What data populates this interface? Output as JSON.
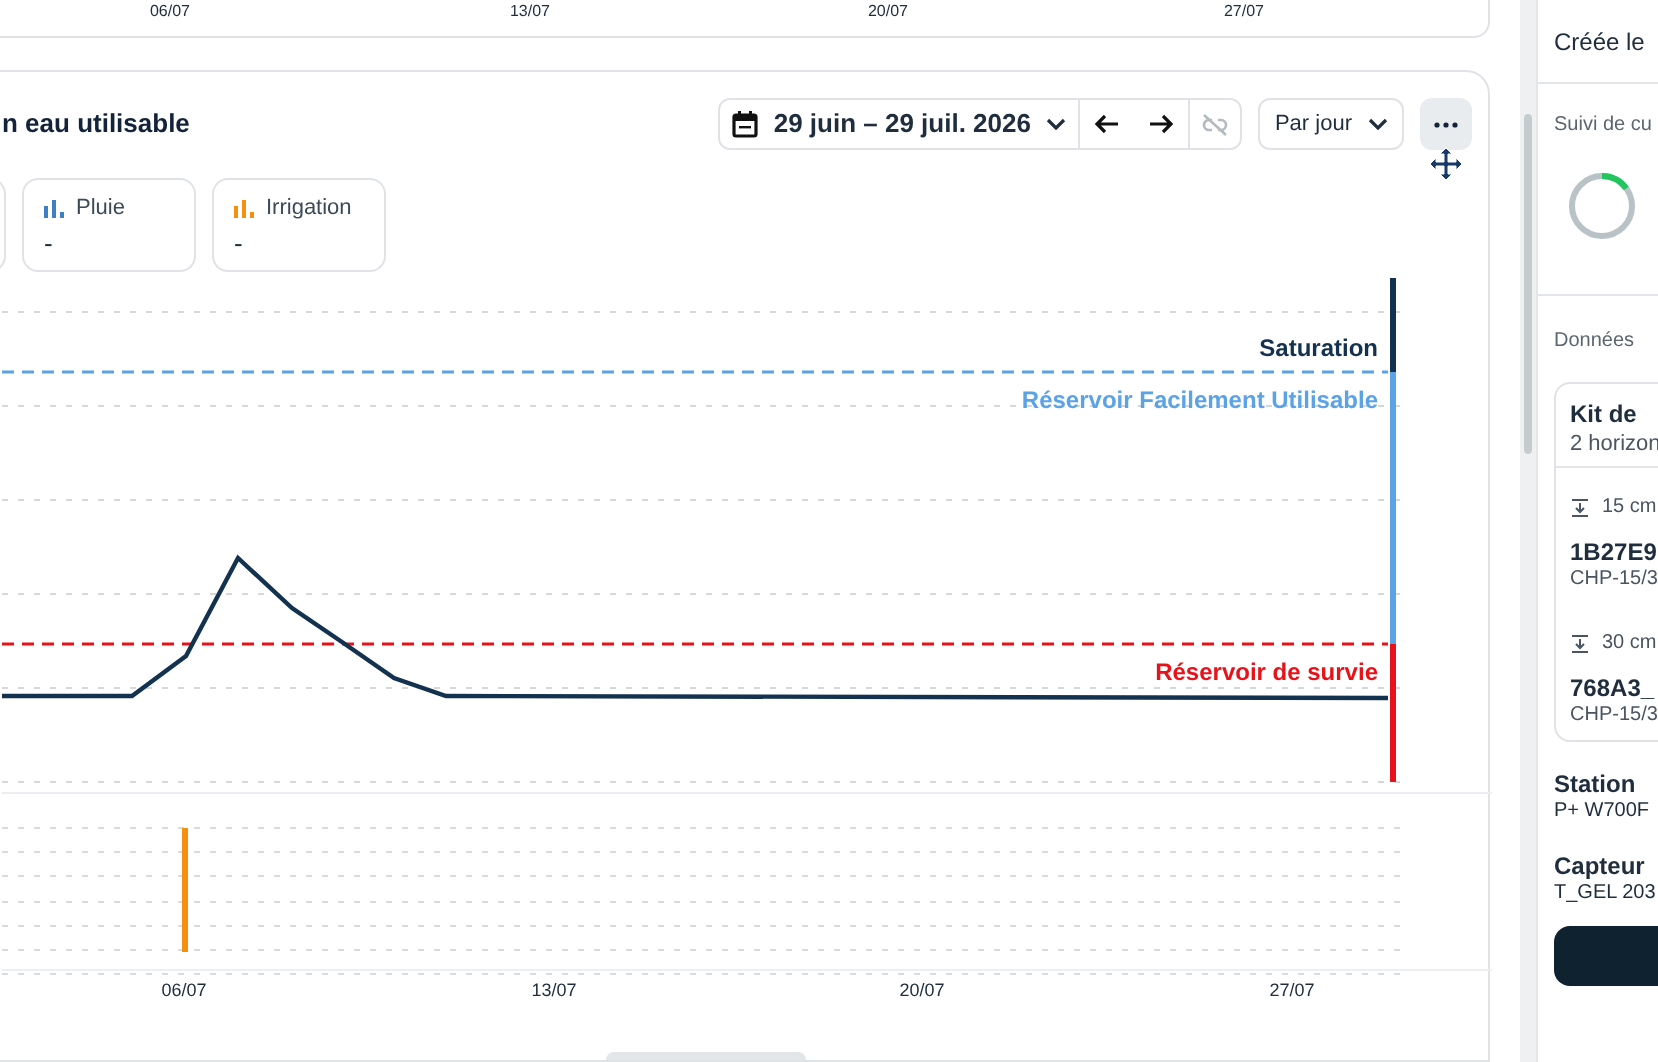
{
  "top_chart": {
    "x_labels": [
      "06/07",
      "13/07",
      "20/07",
      "27/07"
    ]
  },
  "card": {
    "title": "n eau utilisable",
    "date_range": "29 juin – 29 juil. 2026",
    "granularity": "Par jour",
    "legend": [
      {
        "label": "Pluie",
        "value": "-",
        "color": "#3f7fc4"
      },
      {
        "label": "Irrigation",
        "value": "-",
        "color": "#f5900f"
      }
    ],
    "thresholds": [
      {
        "label": "Saturation",
        "color": "#13324f"
      },
      {
        "label": "Réservoir Facilement Utilisable",
        "color": "#5ba3e6"
      },
      {
        "label": "Réservoir de survie",
        "color": "#e8121a"
      }
    ],
    "x_labels": [
      "06/07",
      "13/07",
      "20/07",
      "27/07"
    ]
  },
  "side_panel": {
    "created": "Créée le",
    "tracking_title": "Suivi de cu",
    "data_title": "Données",
    "kit": {
      "title": "Kit de",
      "subtitle": "2 horizon",
      "sensors": [
        {
          "depth": "15 cm",
          "id": "1B27E9",
          "model": "CHP-15/3"
        },
        {
          "depth": "30 cm",
          "id": "768A3_",
          "model": "CHP-15/3"
        }
      ]
    },
    "items": [
      {
        "title": "Station",
        "value": "P+ W700F"
      },
      {
        "title": "Capteur",
        "value": "T_GEL 203"
      }
    ]
  }
}
